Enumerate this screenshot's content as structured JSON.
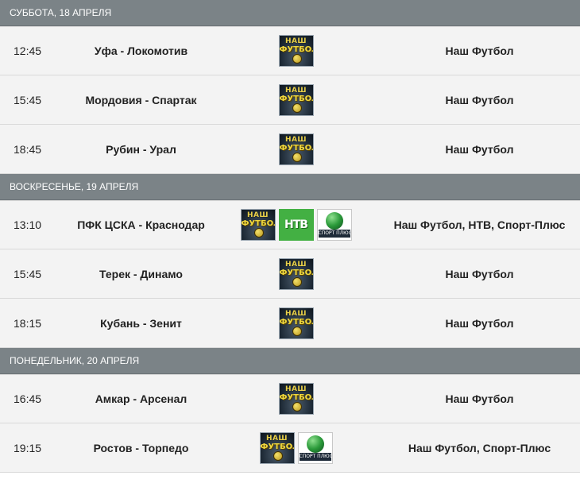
{
  "channel_names": {
    "nash_futbol_top": "НАШ",
    "nash_futbol_main": "ФУТБОЛ",
    "ntv": "НТВ",
    "sport_plus": "СПОРТ ПЛЮС"
  },
  "colors": {
    "header_bg": "#7b8387",
    "row_bg": "#f3f3f3",
    "ntv_green": "#43b043",
    "nash_futbol_yellow": "#f0d83e"
  },
  "days": [
    {
      "title": "СУББОТА, 18 АПРЕЛЯ",
      "matches": [
        {
          "time": "12:45",
          "match": "Уфа - Локомотив",
          "logos": [
            "nash_futbol"
          ],
          "channels": "Наш Футбол"
        },
        {
          "time": "15:45",
          "match": "Мордовия - Спартак",
          "logos": [
            "nash_futbol"
          ],
          "channels": "Наш Футбол"
        },
        {
          "time": "18:45",
          "match": "Рубин - Урал",
          "logos": [
            "nash_futbol"
          ],
          "channels": "Наш Футбол"
        }
      ]
    },
    {
      "title": "ВОСКРЕСЕНЬЕ, 19 АПРЕЛЯ",
      "matches": [
        {
          "time": "13:10",
          "match": "ПФК ЦСКА - Краснодар",
          "logos": [
            "nash_futbol",
            "ntv",
            "sport_plus"
          ],
          "channels": "Наш Футбол, НТВ, Спорт-Плюс"
        },
        {
          "time": "15:45",
          "match": "Терек - Динамо",
          "logos": [
            "nash_futbol"
          ],
          "channels": "Наш Футбол"
        },
        {
          "time": "18:15",
          "match": "Кубань - Зенит",
          "logos": [
            "nash_futbol"
          ],
          "channels": "Наш Футбол"
        }
      ]
    },
    {
      "title": "ПОНЕДЕЛЬНИК, 20 АПРЕЛЯ",
      "matches": [
        {
          "time": "16:45",
          "match": "Амкар - Арсенал",
          "logos": [
            "nash_futbol"
          ],
          "channels": "Наш Футбол"
        },
        {
          "time": "19:15",
          "match": "Ростов - Торпедо",
          "logos": [
            "nash_futbol",
            "sport_plus"
          ],
          "channels": "Наш Футбол, Спорт-Плюс"
        }
      ]
    }
  ]
}
